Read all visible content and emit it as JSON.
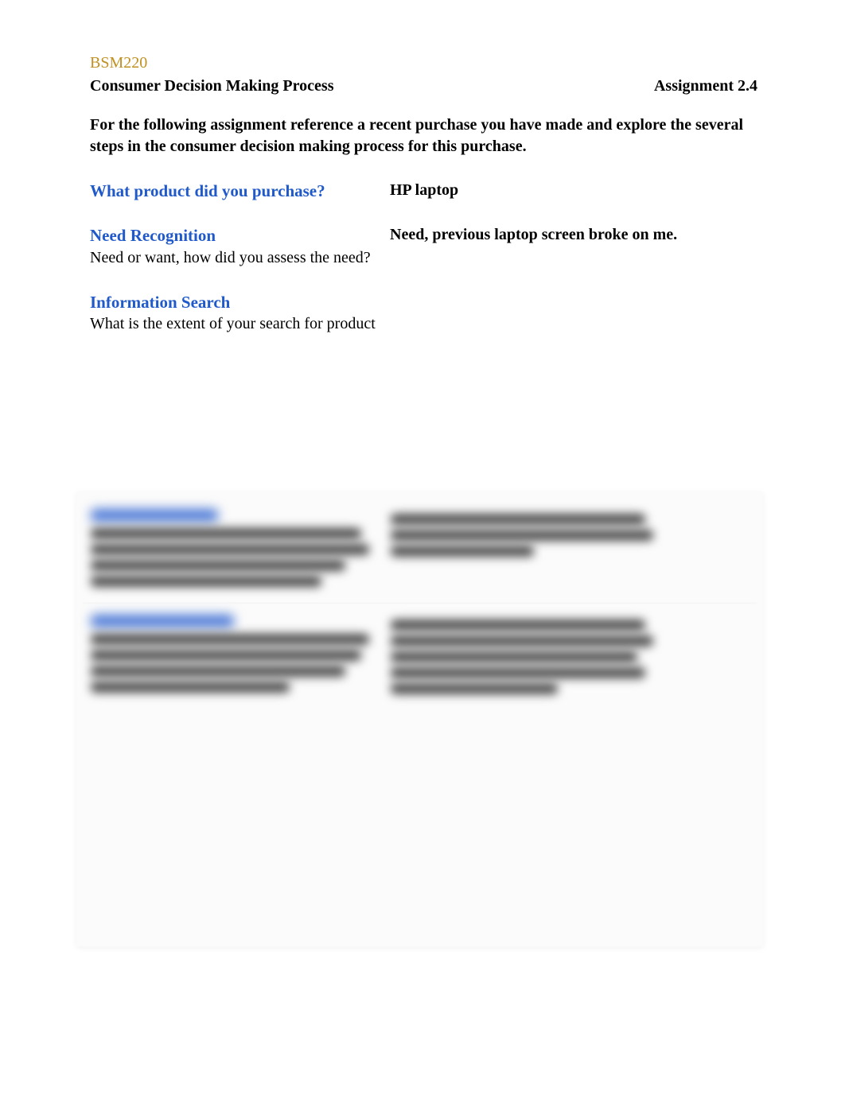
{
  "course_code": "BSM220",
  "header": {
    "left": "Consumer Decision Making Process",
    "right": "Assignment 2.4"
  },
  "instructions": "For the following assignment reference a recent purchase you have made and explore the several steps in the consumer decision making process for this purchase.",
  "sections": {
    "product": {
      "heading": "What product did you purchase?",
      "answer": "HP laptop"
    },
    "need_recognition": {
      "heading": "Need Recognition",
      "sub": " Need or want, how did you assess the need?",
      "answer": "Need, previous laptop screen broke on me."
    },
    "information_search": {
      "heading": "Information Search",
      "sub": "What is the extent of your search for product"
    }
  }
}
